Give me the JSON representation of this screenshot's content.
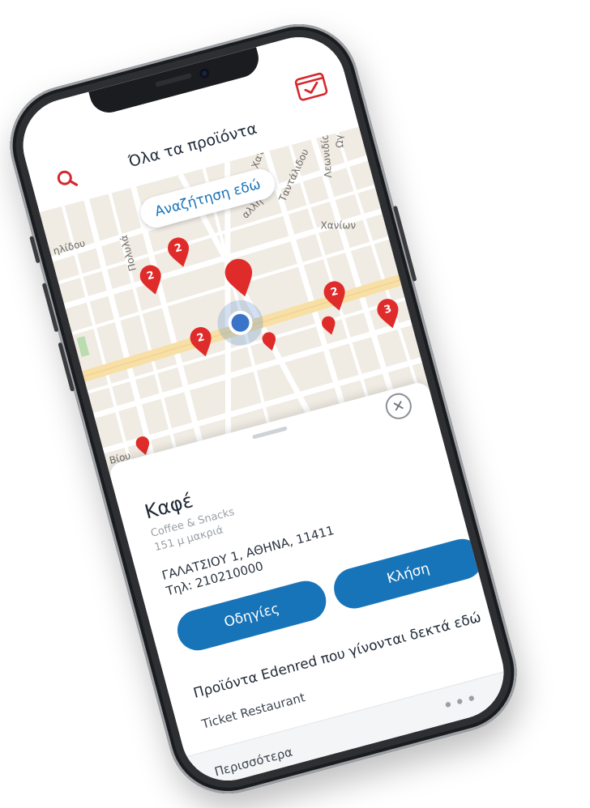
{
  "header": {
    "title": "Όλα τα προϊόντα",
    "search_icon": "search-icon",
    "card_icon": "card-check-icon",
    "accent": "#d6282f"
  },
  "map": {
    "search_here_label": "Αναζήτηση εδώ",
    "street_labels": [
      "ηλίδου",
      "Πολυλά",
      "Β. Χατζή",
      "Ταντάλιδου",
      "Λεωνιδίου",
      "Χανίων",
      "αλλη",
      "Βίου",
      "Ωγ"
    ],
    "pin_counts": [
      "2",
      "2",
      "2",
      "2",
      "3"
    ],
    "pin_color": "#e02b2b"
  },
  "place": {
    "name": "Καφέ",
    "category": "Coffee & Snacks",
    "distance": "151 μ μακριά",
    "address": "ΓΑΛΑΤΣΙΟΥ 1, ΑΘΗΝΑ, 11411",
    "phone": "Τηλ: 210210000"
  },
  "actions": {
    "directions_label": "Οδηγίες",
    "call_label": "Κλήση",
    "button_color": "#1874b8"
  },
  "products": {
    "heading": "Προϊόντα Edenred που γίνονται δεκτά εδώ",
    "items": [
      "Ticket Restaurant"
    ]
  },
  "footer": {
    "more_label": "Περισσότερα",
    "more_dots": "•••"
  }
}
